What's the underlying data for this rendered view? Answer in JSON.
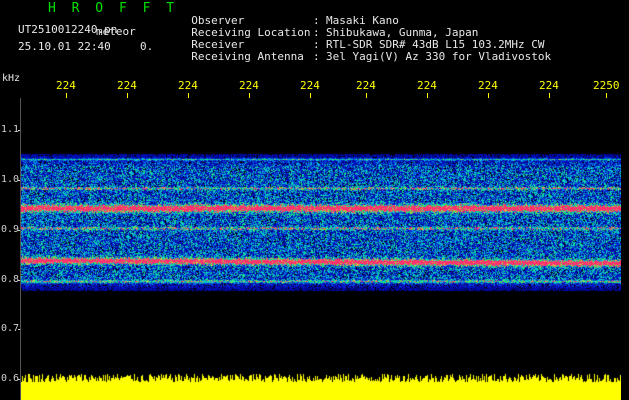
{
  "header": {
    "title": "H R O F F T",
    "filename": "UT2510012240.pn",
    "meteor_label": "meteor",
    "date": "25.10.01 22:40",
    "count": "0."
  },
  "info": [
    {
      "key": "Observer",
      "value": "Masaki Kano"
    },
    {
      "key": "Receiving Location",
      "value": "Shibukawa, Gunma, Japan"
    },
    {
      "key": "Receiver",
      "value": "RTL-SDR SDR# 43dB L15 103.2MHz CW"
    },
    {
      "key": "Receiving Antenna",
      "value": "3el Yagi(V) Az 330 for Vladivostok"
    }
  ],
  "info_separator": ":",
  "axis": {
    "unit": "kHz",
    "y_ticks": [
      "1.1",
      "1.0",
      "0.9",
      "0.8",
      "0.7",
      "0.6"
    ],
    "time_ticks": [
      "224",
      "224",
      "224",
      "224",
      "224",
      "224",
      "224",
      "224",
      "224",
      "2250"
    ]
  },
  "colors": {
    "background": "#000000",
    "title": "#00e000",
    "time_ticks": "#ffff00",
    "echo_power": "#ffff00",
    "signal_strong": "#ff3070",
    "noise_low": "#1030c0"
  }
}
